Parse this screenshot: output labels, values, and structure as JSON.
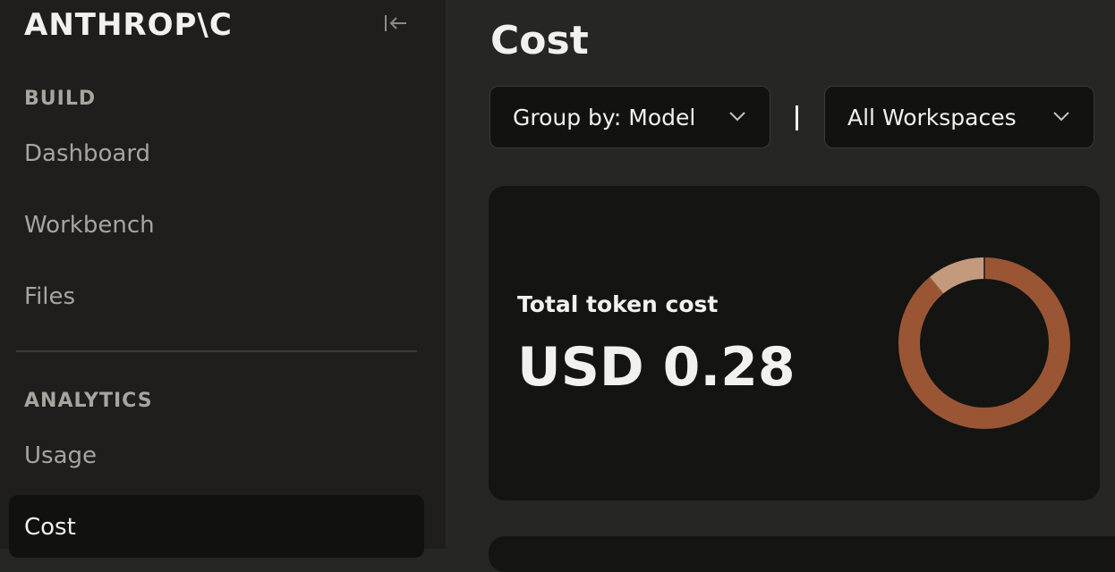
{
  "brand": "ANTHROP\\C",
  "sidebar": {
    "sections": [
      {
        "label": "BUILD",
        "items": [
          {
            "label": "Dashboard"
          },
          {
            "label": "Workbench"
          },
          {
            "label": "Files"
          }
        ]
      },
      {
        "label": "ANALYTICS",
        "items": [
          {
            "label": "Usage"
          },
          {
            "label": "Cost"
          }
        ]
      }
    ],
    "active_item": "Cost"
  },
  "main": {
    "title": "Cost",
    "filters": {
      "group_by": "Group by: Model",
      "separator": "|",
      "workspace": "All Workspaces"
    },
    "card": {
      "label": "Total token cost",
      "value": "USD 0.28",
      "donut_segments": [
        {
          "fraction": 0.89,
          "color": "#9a5634"
        },
        {
          "fraction": 0.11,
          "color": "#c49a7d"
        }
      ]
    }
  },
  "icons": {
    "collapse": "collapse-sidebar-icon",
    "dropdown": "chevron-down-icon"
  }
}
